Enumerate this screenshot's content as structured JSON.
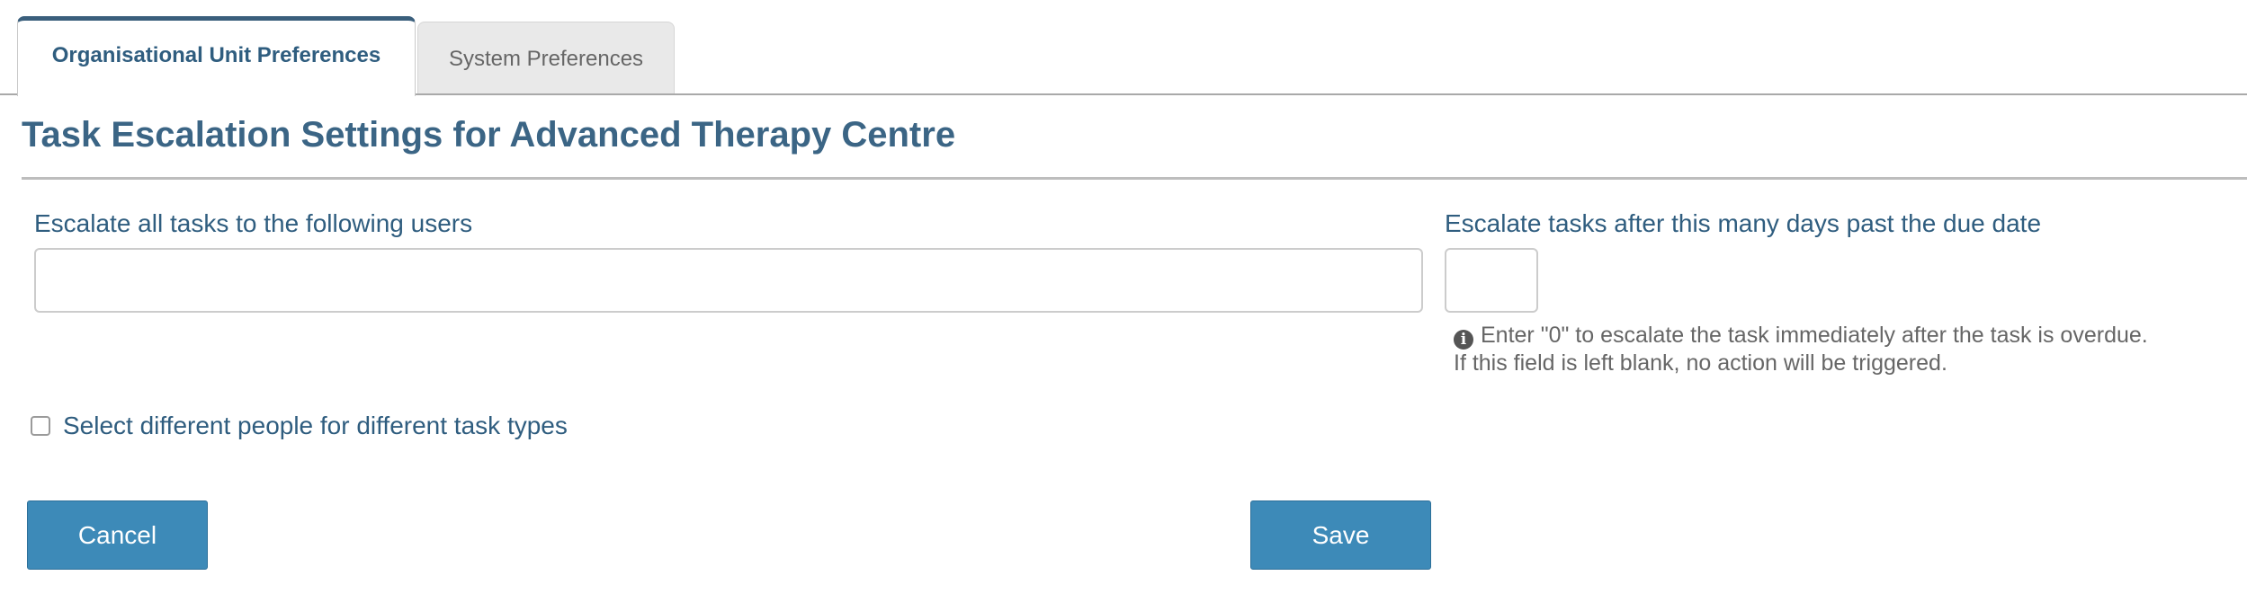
{
  "tabs": [
    {
      "label": "Organisational Unit Preferences",
      "active": true
    },
    {
      "label": "System Preferences",
      "active": false
    }
  ],
  "page": {
    "title": "Task Escalation Settings for Advanced Therapy Centre"
  },
  "form": {
    "users_label": "Escalate all tasks to the following users",
    "users_value": "",
    "days_label": "Escalate tasks after this many days past the due date",
    "days_value": "",
    "help_line_1": "Enter \"0\" to escalate the task immediately after the task is overdue.",
    "help_line_2": "If this field is left blank, no action will be triggered.",
    "checkbox_label": "Select different people for different task types",
    "checkbox_checked": false
  },
  "buttons": {
    "cancel_label": "Cancel",
    "save_label": "Save"
  },
  "colors": {
    "heading": "#3b6585",
    "label": "#2f5d7f",
    "button": "#3d8ab8",
    "active_tab_border": "#3a5f7c",
    "inactive_tab_bg": "#e9e9e9"
  },
  "icons": {
    "help": "info-circle-icon"
  }
}
